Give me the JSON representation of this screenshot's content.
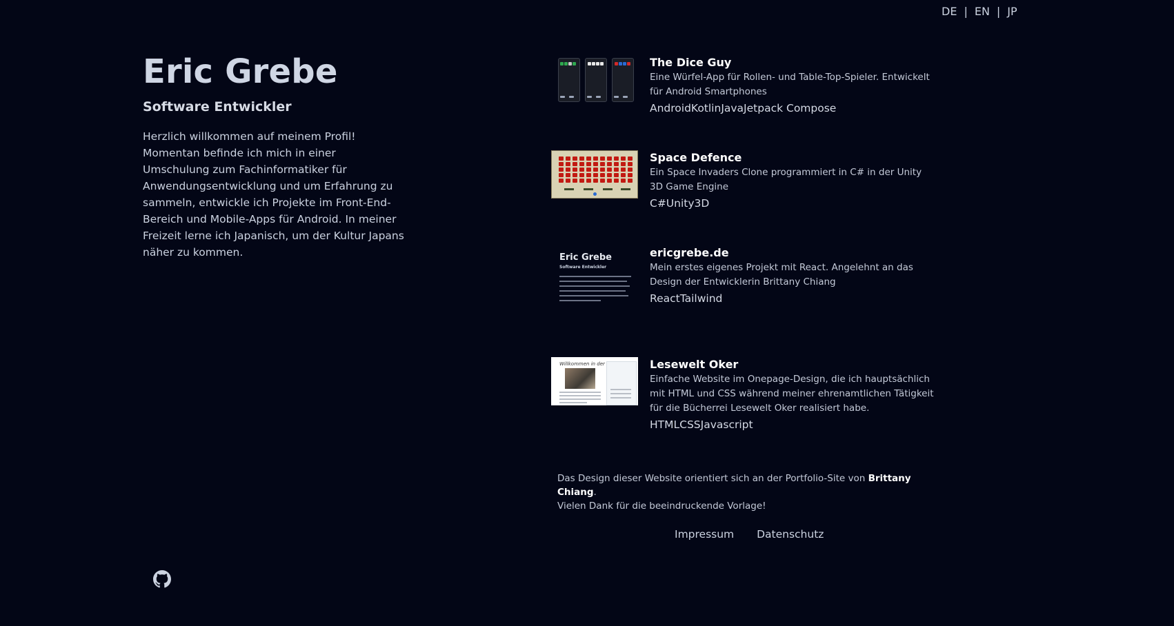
{
  "lang_switch": {
    "de": "DE",
    "en": "EN",
    "jp": "JP",
    "separator": "|"
  },
  "profile": {
    "name": "Eric Grebe",
    "role": "Software Entwickler",
    "intro": "Herzlich willkommen auf meinem Profil! Momentan befinde ich mich in einer Umschulung zum Fachinformatiker für Anwendungsentwicklung und um Erfahrung zu sammeln, entwickle ich Projekte im Front-End-Bereich und Mobile-Apps für Android. In meiner Freizeit lerne ich Japanisch, um der Kultur Japans näher zu kommen."
  },
  "projects": [
    {
      "title": "The Dice Guy",
      "description": "Eine Würfel-App für Rollen- und Table-Top-Spieler. Entwickelt für Android Smartphones",
      "tech": "AndroidKotlinJavaJetpack Compose"
    },
    {
      "title": "Space Defence",
      "description": "Ein Space Invaders Clone programmiert in C# in der Unity 3D Game Engine",
      "tech": "C#Unity3D"
    },
    {
      "title": "ericgrebe.de",
      "description": "Mein erstes eigenes Projekt mit React. Angelehnt an das Design der Entwicklerin Brittany Chiang",
      "tech": "ReactTailwind",
      "thumb_title": "Eric Grebe",
      "thumb_subtitle": "Software Entwickler"
    },
    {
      "title": "Lesewelt Oker",
      "description": "Einfache Website im Onepage-Design, die ich hauptsächlich mit HTML und CSS während meiner ehrenamtlichen Tätigkeit für die Bücherrei Lesewelt Oker realisiert habe.",
      "tech": "HTMLCSSJavascript",
      "thumb_heading": "Willkommen in der Lesewelt"
    }
  ],
  "credit": {
    "prefix": "Das Design dieser Website orientiert sich an der Portfolio-Site von ",
    "author": "Brittany Chiang",
    "suffix": ".",
    "line2": "Vielen Dank für die beeindruckende Vorlage!"
  },
  "footer": {
    "impressum": "Impressum",
    "datenschutz": "Datenschutz"
  },
  "icons": {
    "github": "github-icon"
  },
  "colors": {
    "background": "#030616",
    "text": "#cbd2e0",
    "heading": "#ffffff"
  }
}
